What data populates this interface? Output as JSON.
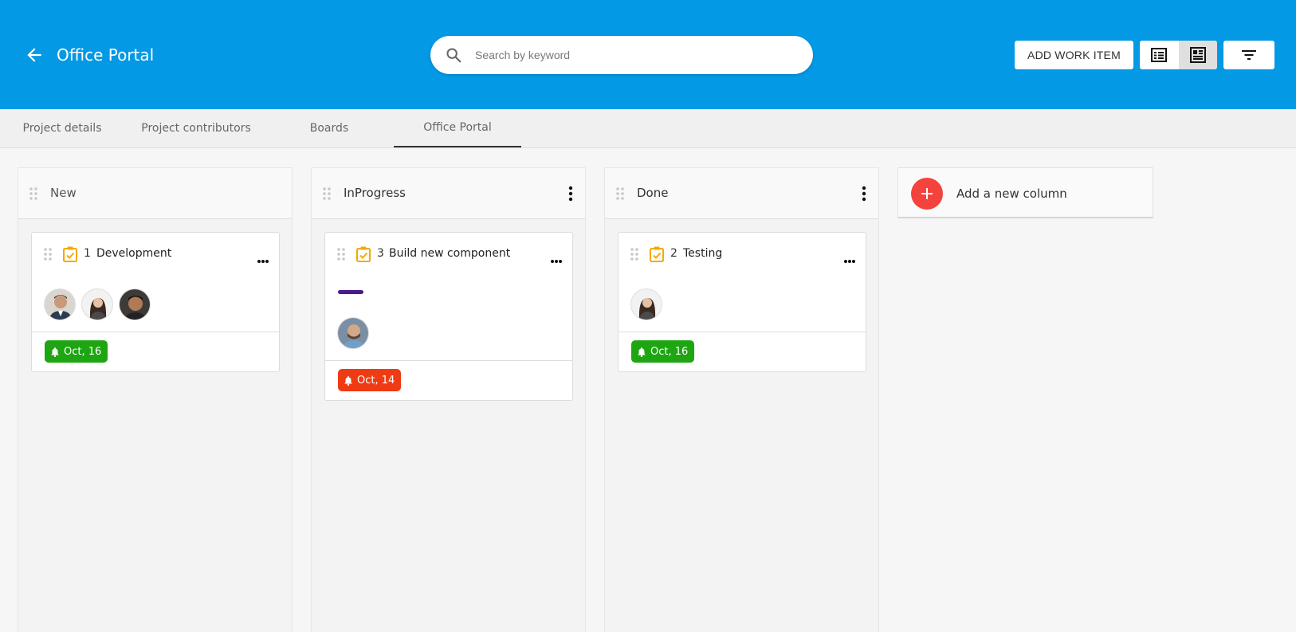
{
  "header": {
    "title": "Office Portal",
    "search_placeholder": "Search by keyword",
    "add_work_item_label": "ADD WORK ITEM",
    "view_options": [
      "list-view",
      "board-view"
    ],
    "active_view": "board-view",
    "background_color": "#0399e4"
  },
  "tabs": [
    {
      "label": "Project details",
      "active": false
    },
    {
      "label": "Project contributors",
      "active": false
    },
    {
      "label": "Boards",
      "active": false
    },
    {
      "label": "Office Portal",
      "active": true
    }
  ],
  "columns": [
    {
      "title": "New",
      "has_menu": false,
      "cards": [
        {
          "number": "1",
          "title": "Development",
          "assignees": 3,
          "due": "Oct, 16",
          "due_status": "on-track",
          "due_color": "#1ea512"
        }
      ]
    },
    {
      "title": "InProgress",
      "has_menu": true,
      "cards": [
        {
          "number": "3",
          "title": "Build new component",
          "assignees": 1,
          "tag_color": "#4a1a8a",
          "due": "Oct, 14",
          "due_status": "overdue",
          "due_color": "#ee3b14"
        }
      ]
    },
    {
      "title": "Done",
      "has_menu": true,
      "cards": [
        {
          "number": "2",
          "title": "Testing",
          "assignees": 1,
          "due": "Oct, 16",
          "due_status": "on-track",
          "due_color": "#1ea512"
        }
      ]
    }
  ],
  "add_column": {
    "label": "Add a new column",
    "accent_color": "#f4433c"
  },
  "colors": {
    "checklist_icon": "#f5a800",
    "task_tag": "#4a1a8a"
  }
}
